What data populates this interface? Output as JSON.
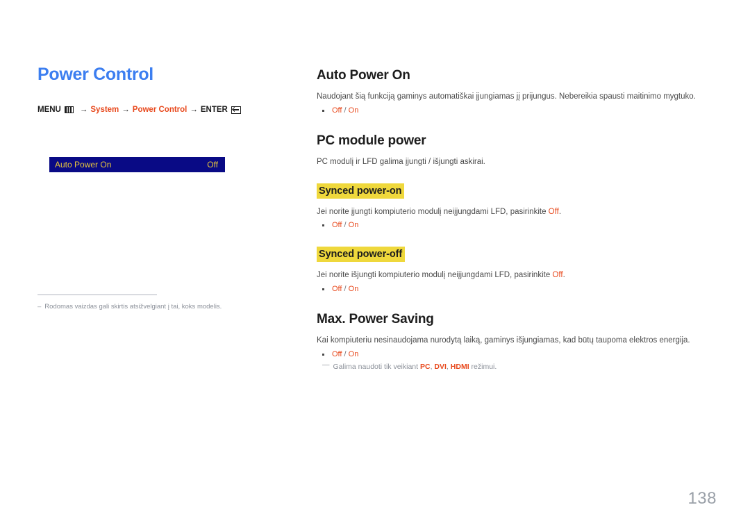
{
  "document": {
    "page_number": "138",
    "page_title": "Power Control"
  },
  "breadcrumb": {
    "menu_label": "MENU",
    "menu_icon": "menu-grid-icon",
    "arrow": "→",
    "item1": "System",
    "item2": "Power Control",
    "enter_label": "ENTER",
    "enter_icon": "enter-return-icon"
  },
  "osd": {
    "label": "Auto Power On",
    "value": "Off",
    "background_color": "#090a85",
    "text_color": "#e8c63c"
  },
  "left_note": {
    "dash": "–",
    "text": "Rodomas vaizdas gali skirtis atsižvelgiant į tai, koks modelis."
  },
  "sections": {
    "auto_power_on": {
      "title": "Auto Power On",
      "body": "Naudojant šią funkciją gaminys automatiškai įjungiamas jį prijungus. Nebereikia spausti maitinimo mygtuko.",
      "option_off": "Off",
      "option_sep": "/",
      "option_on": "On"
    },
    "pc_module_power": {
      "title": "PC module power",
      "body": "PC modulį ir LFD galima įjungti / išjungti askirai."
    },
    "synced_power_on": {
      "title": "Synced power-on",
      "body_before": "Jei norite įjungti kompiuterio modulį neiįjungdami LFD, pasirinkite ",
      "body_accent": "Off",
      "body_after": ".",
      "option_off": "Off",
      "option_sep": "/",
      "option_on": "On"
    },
    "synced_power_off": {
      "title": "Synced power-off",
      "body_before": "Jei norite išjungti kompiuterio modulį neiįjungdami LFD, pasirinkite ",
      "body_accent": "Off",
      "body_after": ".",
      "option_off": "Off",
      "option_sep": "/",
      "option_on": "On"
    },
    "max_power_saving": {
      "title": "Max. Power Saving",
      "body": "Kai kompiuteriu nesinaudojama nurodytą laiką, gaminys išjungiamas, kad būtų taupoma elektros energija.",
      "option_off": "Off",
      "option_sep": "/",
      "option_on": "On",
      "note_dash": "—",
      "note_before": "Galima naudoti tik veikiant ",
      "note_mode1": "PC",
      "note_comma1": ",",
      "note_mode2": "DVI",
      "note_comma2": ",",
      "note_mode3": "HDMI",
      "note_after": " režimui."
    }
  },
  "colors": {
    "title_blue": "#3c7ef0",
    "accent_orange": "#e8491d",
    "highlight_yellow": "#efd83c",
    "muted_gray": "#8b9099"
  }
}
